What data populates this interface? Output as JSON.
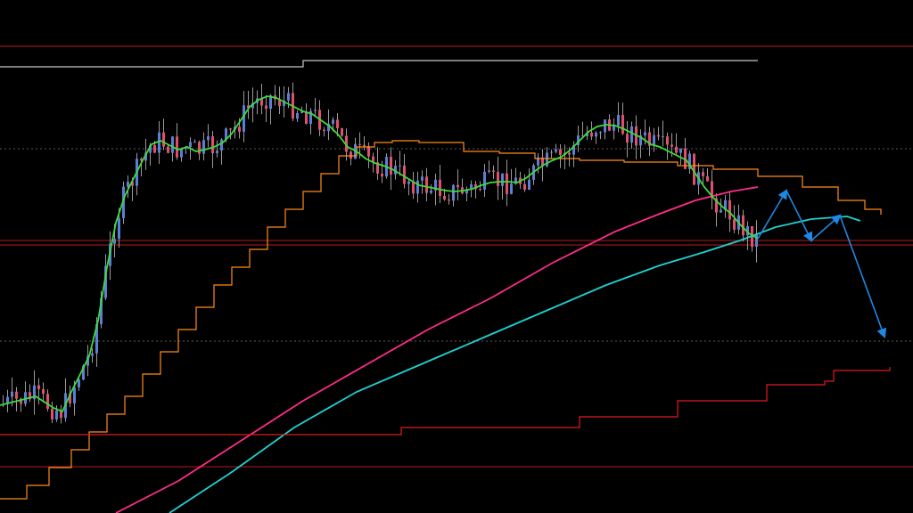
{
  "chart_data": {
    "type": "candlestick",
    "title": "",
    "xlabel": "",
    "ylabel": "",
    "grid": false,
    "legend": "none",
    "ylim": [
      0,
      576
    ],
    "horizontal_levels": [
      {
        "name": "",
        "y": 524,
        "color": "#b71c1c",
        "dash": false
      },
      {
        "name": "",
        "y": 52,
        "color": "#b71c1c",
        "dash": false
      },
      {
        "name": "",
        "y": 270,
        "color": "#b71c1c",
        "dash": false
      },
      {
        "name": "",
        "y": 275,
        "color": "#b71c1c",
        "dash": false
      },
      {
        "name": "",
        "y": 167,
        "color": "#7a7a7a",
        "dash": true
      },
      {
        "name": "",
        "y": 383,
        "color": "#7a7a7a",
        "dash": true
      }
    ],
    "series": [
      {
        "name": "",
        "kind": "line",
        "color": "#ffffff",
        "step": true,
        "x": [
          0,
          330,
          340,
          850
        ],
        "y": [
          75,
          75,
          68,
          68
        ]
      },
      {
        "name": "",
        "kind": "line",
        "color": "#ff8c1a",
        "step": true,
        "x": [
          0,
          30,
          55,
          80,
          100,
          120,
          140,
          160,
          180,
          200,
          220,
          240,
          260,
          280,
          300,
          320,
          340,
          360,
          380,
          400,
          420,
          440,
          470,
          520,
          560,
          600,
          650,
          700,
          760,
          800,
          850,
          900,
          940,
          970,
          988
        ],
        "y": [
          560,
          545,
          525,
          505,
          485,
          465,
          445,
          420,
          395,
          370,
          345,
          320,
          300,
          280,
          255,
          235,
          215,
          195,
          175,
          165,
          160,
          158,
          160,
          170,
          172,
          178,
          180,
          182,
          186,
          190,
          198,
          210,
          225,
          235,
          241
        ]
      },
      {
        "name": "",
        "kind": "line",
        "color": "#ff2d8a",
        "step": false,
        "x": [
          130,
          200,
          270,
          340,
          410,
          480,
          550,
          620,
          690,
          740,
          780,
          820,
          850
        ],
        "y": [
          576,
          540,
          495,
          450,
          410,
          370,
          335,
          295,
          260,
          240,
          225,
          215,
          210
        ]
      },
      {
        "name": "",
        "kind": "line",
        "color": "#1fd2d2",
        "step": false,
        "x": [
          190,
          260,
          330,
          400,
          470,
          540,
          610,
          680,
          740,
          790,
          830,
          870,
          910,
          950,
          965
        ],
        "y": [
          576,
          530,
          480,
          440,
          410,
          380,
          350,
          320,
          298,
          283,
          270,
          255,
          246,
          243,
          248
        ]
      },
      {
        "name": "",
        "kind": "line",
        "color": "#ffffff",
        "step": false,
        "x": [
          0,
          20,
          40,
          60,
          70,
          80,
          90,
          100,
          110,
          120,
          130,
          140,
          150,
          160,
          170,
          180,
          190,
          200,
          210,
          220,
          230,
          240,
          250,
          260,
          270,
          280,
          290,
          300,
          310,
          320,
          330,
          340,
          350,
          360,
          370,
          380,
          390,
          400,
          410,
          420,
          430,
          440,
          450,
          460,
          470,
          480,
          490,
          500,
          510,
          520,
          530,
          540,
          550,
          560,
          570,
          580,
          590,
          600,
          610,
          620,
          630,
          640,
          650,
          660,
          670,
          680,
          690,
          700,
          710,
          720,
          730,
          740,
          750,
          760,
          770,
          780,
          790,
          800,
          810,
          820,
          830,
          840,
          850
        ],
        "y": [
          455,
          450,
          445,
          458,
          462,
          440,
          420,
          400,
          360,
          300,
          250,
          220,
          200,
          180,
          162,
          158,
          163,
          168,
          165,
          170,
          168,
          165,
          160,
          150,
          135,
          120,
          112,
          108,
          110,
          115,
          120,
          125,
          128,
          135,
          142,
          152,
          165,
          170,
          178,
          183,
          186,
          190,
          196,
          202,
          208,
          210,
          212,
          214,
          215,
          214,
          212,
          208,
          205,
          204,
          204,
          205,
          200,
          192,
          185,
          180,
          176,
          168,
          158,
          148,
          142,
          140,
          141,
          145,
          150,
          155,
          162,
          165,
          170,
          175,
          180,
          195,
          210,
          222,
          232,
          240,
          252,
          262,
          268
        ]
      },
      {
        "name": "",
        "kind": "line",
        "color": "#e01c1c",
        "step": true,
        "x": [
          0,
          140,
          440,
          450,
          540,
          550,
          640,
          650,
          750,
          760,
          850,
          860,
          915,
          925,
          935,
          990,
          998
        ],
        "y": [
          488,
          488,
          488,
          480,
          480,
          480,
          480,
          468,
          468,
          450,
          450,
          432,
          432,
          428,
          416,
          416,
          412
        ]
      },
      {
        "name": "",
        "kind": "arrow",
        "color": "#1e88e5",
        "step": false,
        "x": [
          850,
          882,
          910,
          942,
          992
        ],
        "y": [
          268,
          214,
          270,
          242,
          378
        ]
      }
    ]
  }
}
